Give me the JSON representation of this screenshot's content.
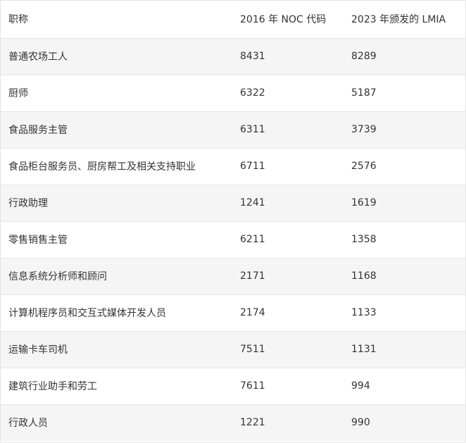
{
  "table": {
    "headers": [
      "职称",
      "2016 年 NOC 代码",
      "2023 年颁发的 LMIA"
    ],
    "rows": [
      [
        "普通农场工人",
        "8431",
        "8289"
      ],
      [
        "厨师",
        "6322",
        "5187"
      ],
      [
        "食品服务主管",
        "6311",
        "3739"
      ],
      [
        "食品柜台服务员、厨房帮工及相关支持职业",
        "6711",
        "2576"
      ],
      [
        "行政助理",
        "1241",
        "1619"
      ],
      [
        "零售销售主管",
        "6211",
        "1358"
      ],
      [
        "信息系统分析师和顾问",
        "2171",
        "1168"
      ],
      [
        "计算机程序员和交互式媒体开发人员",
        "2174",
        "1133"
      ],
      [
        "运输卡车司机",
        "7511",
        "1131"
      ],
      [
        "建筑行业助手和劳工",
        "7611",
        "994"
      ],
      [
        "行政人员",
        "1221",
        "990"
      ]
    ]
  }
}
